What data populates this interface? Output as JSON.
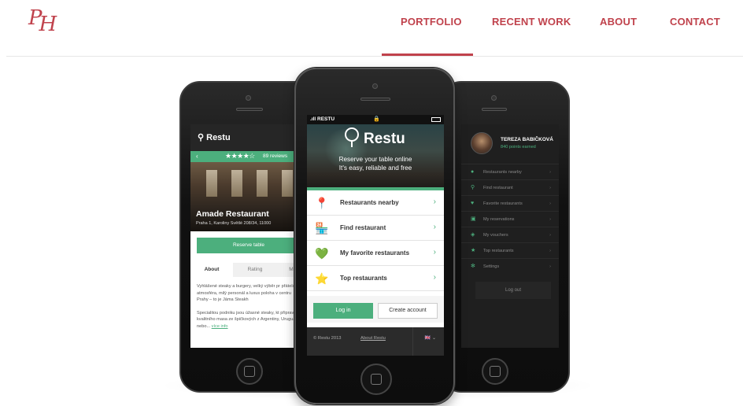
{
  "header": {
    "logo": {
      "line1": "P",
      "line2": "H"
    },
    "nav": [
      {
        "label": "PORTFOLIO",
        "active": true
      },
      {
        "label": "RECENT WORK"
      },
      {
        "label": "ABOUT"
      },
      {
        "label": "CONTACT"
      }
    ],
    "accent_color": "#c0424c"
  },
  "left_phone": {
    "app_title": "Restu",
    "back": "‹",
    "stars": "★★★★☆",
    "reviews": "89 reviews",
    "restaurant": "Amade Restaurant",
    "address": "Praha 1, Karoliny Světlé 208/34, 11000",
    "reserve": "Reserve table",
    "tabs": [
      "About",
      "Rating",
      "M"
    ],
    "text1": "Vyhlášené steaky a burgery, velký výběr pr přátelská atmosféra, milý personál a luxus poloha v centru Prahy – to je Jáma Steakh",
    "text2": "Specialitou podniku jsou úžasné steaky, kt připravují z kvalitního masa ze špičkových z Argentiny, Uruguaye nebo...",
    "more": "více info"
  },
  "center_phone": {
    "carrier": ".ıll RESTU",
    "lock": "🔒",
    "brand": "Restu",
    "tagline1": "Reserve your table online",
    "tagline2": "It's easy, reliable and free",
    "menu": [
      {
        "icon": "map-pin-icon",
        "glyph": "📍",
        "label": "Restaurants nearby"
      },
      {
        "icon": "store-search-icon",
        "glyph": "🏪",
        "label": "Find restaurant"
      },
      {
        "icon": "heart-icon",
        "glyph": "💚",
        "label": "My favorite restaurants"
      },
      {
        "icon": "star-badge-icon",
        "glyph": "⭐",
        "label": "Top restaurants"
      }
    ],
    "chevron": "›",
    "login": "Log in",
    "create": "Create account",
    "copyright": "© Restu 2013",
    "about": "About Restu",
    "lang": "🇬🇧 ⌄",
    "peek_text": "k",
    "brand_color": "#4caf7d"
  },
  "right_phone": {
    "name": "TEREZA BABIČKOVÁ",
    "points": "840 points earned",
    "menu": [
      {
        "icon": "map-pin-icon",
        "glyph": "●",
        "label": "Restaurants nearby"
      },
      {
        "icon": "search-icon",
        "glyph": "⚲",
        "label": "Find restaurant"
      },
      {
        "icon": "heart-icon",
        "glyph": "♥",
        "label": "Favorite restaurants"
      },
      {
        "icon": "calendar-icon",
        "glyph": "▣",
        "label": "My reservations"
      },
      {
        "icon": "voucher-icon",
        "glyph": "◈",
        "label": "My vouchers"
      },
      {
        "icon": "star-icon",
        "glyph": "★",
        "label": "Top restaurants"
      },
      {
        "icon": "gear-icon",
        "glyph": "✻",
        "label": "Settings"
      }
    ],
    "chevron": "›",
    "logout": "Log out"
  }
}
